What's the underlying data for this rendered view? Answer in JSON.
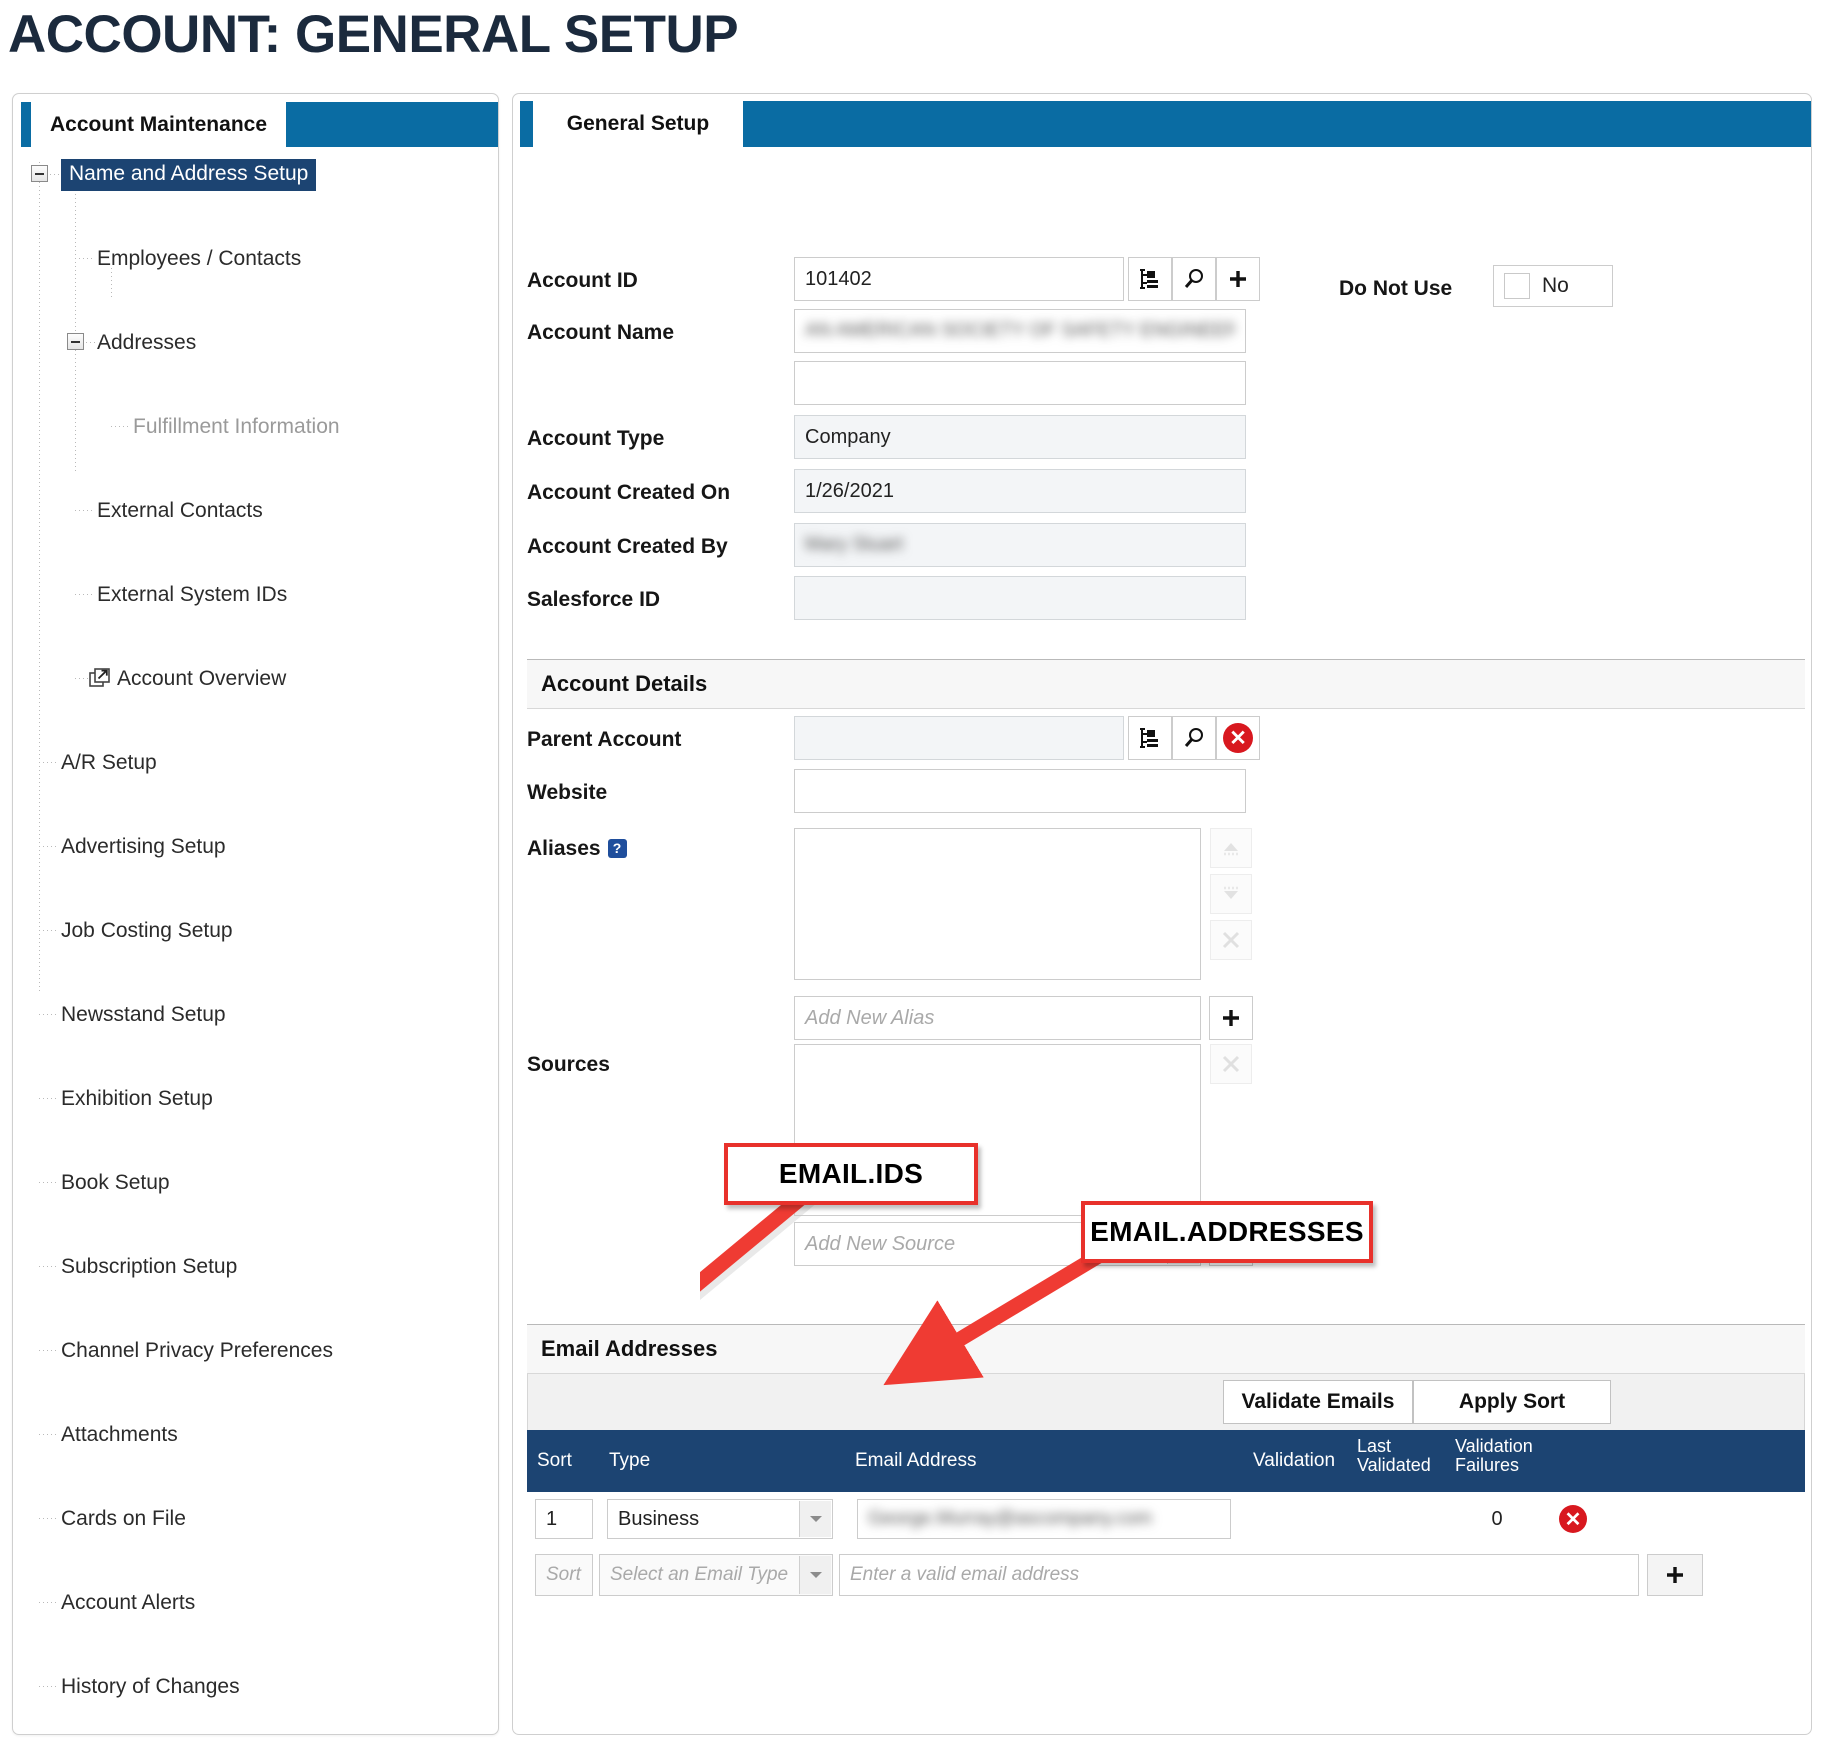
{
  "page": {
    "title": "ACCOUNT: GENERAL SETUP"
  },
  "sidebar": {
    "header": "Account Maintenance",
    "items": [
      {
        "label": "Name and Address Setup",
        "level": 0,
        "selected": true,
        "expander": "minus"
      },
      {
        "label": "Employees / Contacts",
        "level": 1,
        "selected": false
      },
      {
        "label": "Addresses",
        "level": 1,
        "selected": false,
        "expander": "minus"
      },
      {
        "label": "Fulfillment Information",
        "level": 2,
        "selected": false,
        "muted": true
      },
      {
        "label": "External Contacts",
        "level": 1,
        "selected": false
      },
      {
        "label": "External System IDs",
        "level": 1,
        "selected": false
      },
      {
        "label": "Account Overview",
        "level": 1,
        "selected": false,
        "icon": "external-link-icon"
      },
      {
        "label": "A/R Setup",
        "level": 0,
        "selected": false
      },
      {
        "label": "Advertising Setup",
        "level": 0,
        "selected": false
      },
      {
        "label": "Job Costing Setup",
        "level": 0,
        "selected": false
      },
      {
        "label": "Newsstand Setup",
        "level": 0,
        "selected": false
      },
      {
        "label": "Exhibition Setup",
        "level": 0,
        "selected": false
      },
      {
        "label": "Book Setup",
        "level": 0,
        "selected": false
      },
      {
        "label": "Subscription Setup",
        "level": 0,
        "selected": false
      },
      {
        "label": "Channel Privacy Preferences",
        "level": 0,
        "selected": false
      },
      {
        "label": "Attachments",
        "level": 0,
        "selected": false
      },
      {
        "label": "Cards on File",
        "level": 0,
        "selected": false
      },
      {
        "label": "Account Alerts",
        "level": 0,
        "selected": false
      },
      {
        "label": "History of Changes",
        "level": 0,
        "selected": false
      }
    ]
  },
  "main": {
    "tab": "General Setup",
    "fields": {
      "account_id_label": "Account ID",
      "account_id_value": "101402",
      "account_name_label": "Account Name",
      "account_name_value": "AN AMERICAN SOCIETY OF SAFETY ENGINEERS",
      "account_name_line2_value": "",
      "account_type_label": "Account Type",
      "account_type_value": "Company",
      "account_created_on_label": "Account Created On",
      "account_created_on_value": "1/26/2021",
      "account_created_by_label": "Account Created By",
      "account_created_by_value": "Mary Stuart",
      "salesforce_id_label": "Salesforce ID",
      "salesforce_id_value": "",
      "do_not_use_label": "Do Not Use",
      "do_not_use_value": "No"
    },
    "details": {
      "section_title": "Account Details",
      "parent_account_label": "Parent Account",
      "parent_account_value": "",
      "website_label": "Website",
      "website_value": "",
      "aliases_label": "Aliases",
      "aliases_help": "?",
      "add_alias_placeholder": "Add New Alias",
      "sources_label": "Sources",
      "sources_placeholder": "Add New Source"
    },
    "email_section": {
      "title": "Email Addresses",
      "validate_button": "Validate Emails",
      "apply_sort_button": "Apply Sort",
      "columns": [
        "Sort",
        "Type",
        "Email Address",
        "Validation",
        "Last Validated",
        "Validation Failures",
        ""
      ],
      "rows": [
        {
          "sort": "1",
          "type": "Business",
          "email": "George.Murray@ascompany.com",
          "validation": "",
          "last_validated": "",
          "validation_failures": "0",
          "delete_icon": "delete-icon"
        }
      ],
      "new_row": {
        "sort_placeholder": "Sort",
        "type_placeholder": "Select an Email Type",
        "email_placeholder": "Enter a valid email address",
        "add_icon": "plus-icon"
      }
    }
  },
  "annotations": [
    {
      "label": "EMAIL.IDS"
    },
    {
      "label": "EMAIL.ADDRESSES"
    }
  ],
  "colors": {
    "title": "#1b2a3d",
    "panel_header": "#0a6ca3",
    "selected_node": "#1c4472",
    "table_header": "#1c4472",
    "annotation": "#e8312b",
    "delete": "#d8181f"
  }
}
